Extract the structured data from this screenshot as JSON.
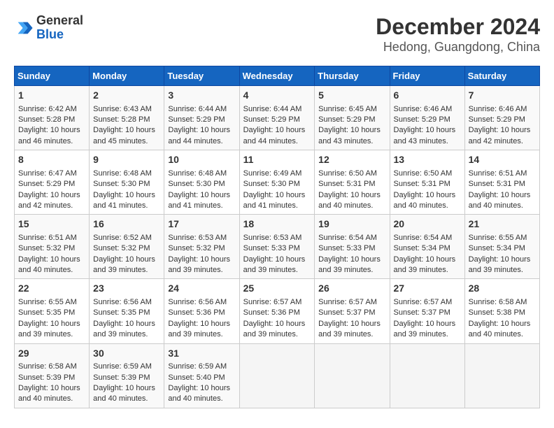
{
  "logo": {
    "general": "General",
    "blue": "Blue"
  },
  "title": "December 2024",
  "subtitle": "Hedong, Guangdong, China",
  "days_of_week": [
    "Sunday",
    "Monday",
    "Tuesday",
    "Wednesday",
    "Thursday",
    "Friday",
    "Saturday"
  ],
  "weeks": [
    [
      {
        "day": "1",
        "sunrise": "6:42 AM",
        "sunset": "5:28 PM",
        "daylight": "10 hours and 46 minutes."
      },
      {
        "day": "2",
        "sunrise": "6:43 AM",
        "sunset": "5:28 PM",
        "daylight": "10 hours and 45 minutes."
      },
      {
        "day": "3",
        "sunrise": "6:44 AM",
        "sunset": "5:29 PM",
        "daylight": "10 hours and 44 minutes."
      },
      {
        "day": "4",
        "sunrise": "6:44 AM",
        "sunset": "5:29 PM",
        "daylight": "10 hours and 44 minutes."
      },
      {
        "day": "5",
        "sunrise": "6:45 AM",
        "sunset": "5:29 PM",
        "daylight": "10 hours and 43 minutes."
      },
      {
        "day": "6",
        "sunrise": "6:46 AM",
        "sunset": "5:29 PM",
        "daylight": "10 hours and 43 minutes."
      },
      {
        "day": "7",
        "sunrise": "6:46 AM",
        "sunset": "5:29 PM",
        "daylight": "10 hours and 42 minutes."
      }
    ],
    [
      {
        "day": "8",
        "sunrise": "6:47 AM",
        "sunset": "5:29 PM",
        "daylight": "10 hours and 42 minutes."
      },
      {
        "day": "9",
        "sunrise": "6:48 AM",
        "sunset": "5:30 PM",
        "daylight": "10 hours and 41 minutes."
      },
      {
        "day": "10",
        "sunrise": "6:48 AM",
        "sunset": "5:30 PM",
        "daylight": "10 hours and 41 minutes."
      },
      {
        "day": "11",
        "sunrise": "6:49 AM",
        "sunset": "5:30 PM",
        "daylight": "10 hours and 41 minutes."
      },
      {
        "day": "12",
        "sunrise": "6:50 AM",
        "sunset": "5:31 PM",
        "daylight": "10 hours and 40 minutes."
      },
      {
        "day": "13",
        "sunrise": "6:50 AM",
        "sunset": "5:31 PM",
        "daylight": "10 hours and 40 minutes."
      },
      {
        "day": "14",
        "sunrise": "6:51 AM",
        "sunset": "5:31 PM",
        "daylight": "10 hours and 40 minutes."
      }
    ],
    [
      {
        "day": "15",
        "sunrise": "6:51 AM",
        "sunset": "5:32 PM",
        "daylight": "10 hours and 40 minutes."
      },
      {
        "day": "16",
        "sunrise": "6:52 AM",
        "sunset": "5:32 PM",
        "daylight": "10 hours and 39 minutes."
      },
      {
        "day": "17",
        "sunrise": "6:53 AM",
        "sunset": "5:32 PM",
        "daylight": "10 hours and 39 minutes."
      },
      {
        "day": "18",
        "sunrise": "6:53 AM",
        "sunset": "5:33 PM",
        "daylight": "10 hours and 39 minutes."
      },
      {
        "day": "19",
        "sunrise": "6:54 AM",
        "sunset": "5:33 PM",
        "daylight": "10 hours and 39 minutes."
      },
      {
        "day": "20",
        "sunrise": "6:54 AM",
        "sunset": "5:34 PM",
        "daylight": "10 hours and 39 minutes."
      },
      {
        "day": "21",
        "sunrise": "6:55 AM",
        "sunset": "5:34 PM",
        "daylight": "10 hours and 39 minutes."
      }
    ],
    [
      {
        "day": "22",
        "sunrise": "6:55 AM",
        "sunset": "5:35 PM",
        "daylight": "10 hours and 39 minutes."
      },
      {
        "day": "23",
        "sunrise": "6:56 AM",
        "sunset": "5:35 PM",
        "daylight": "10 hours and 39 minutes."
      },
      {
        "day": "24",
        "sunrise": "6:56 AM",
        "sunset": "5:36 PM",
        "daylight": "10 hours and 39 minutes."
      },
      {
        "day": "25",
        "sunrise": "6:57 AM",
        "sunset": "5:36 PM",
        "daylight": "10 hours and 39 minutes."
      },
      {
        "day": "26",
        "sunrise": "6:57 AM",
        "sunset": "5:37 PM",
        "daylight": "10 hours and 39 minutes."
      },
      {
        "day": "27",
        "sunrise": "6:57 AM",
        "sunset": "5:37 PM",
        "daylight": "10 hours and 39 minutes."
      },
      {
        "day": "28",
        "sunrise": "6:58 AM",
        "sunset": "5:38 PM",
        "daylight": "10 hours and 40 minutes."
      }
    ],
    [
      {
        "day": "29",
        "sunrise": "6:58 AM",
        "sunset": "5:39 PM",
        "daylight": "10 hours and 40 minutes."
      },
      {
        "day": "30",
        "sunrise": "6:59 AM",
        "sunset": "5:39 PM",
        "daylight": "10 hours and 40 minutes."
      },
      {
        "day": "31",
        "sunrise": "6:59 AM",
        "sunset": "5:40 PM",
        "daylight": "10 hours and 40 minutes."
      },
      null,
      null,
      null,
      null
    ]
  ]
}
